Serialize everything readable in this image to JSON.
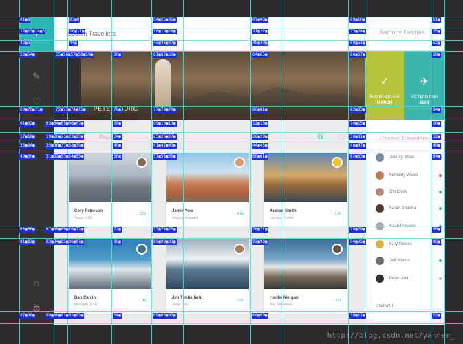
{
  "header": {
    "search_placeholder": "Search Travellers",
    "user_name": "Anthony Delmas"
  },
  "sidebar": {
    "logo_text": "T",
    "icons": [
      "compass-icon",
      "heart-icon",
      "inbox-icon",
      "settings-icon"
    ]
  },
  "hero": {
    "caption": "PETERSBURG",
    "best_time_label": "Best time to visit",
    "best_time_value": "MARCH",
    "flights_label": "20 flights from",
    "flights_value": "350 $",
    "colors": {
      "green_tile": "#b5c43a",
      "teal_tile": "#3bb5ad"
    }
  },
  "content": {
    "section_title": "Popular",
    "cards": [
      {
        "name": "Cory Peterson",
        "location": "Texas, USA",
        "likes": "255",
        "photo": "bridge-river-city"
      },
      {
        "name": "Jamie Yow",
        "location": "Sydney, Australia",
        "likes": "4.5k",
        "photo": "colorful-street"
      },
      {
        "name": "Keeran Smith",
        "location": "Istanbul, Turkey",
        "likes": "1.2k",
        "photo": "canal-sunset"
      },
      {
        "name": "Dan Calvin",
        "location": "Michigan, USA",
        "likes": "4k",
        "photo": "snowy-mountains"
      },
      {
        "name": "Jim Timberland",
        "location": "Sofia, Italy",
        "likes": "150",
        "photo": "ocean-waves"
      },
      {
        "name": "Hoolie Morgan",
        "location": "Bali, Indonesia",
        "likes": "22k",
        "photo": "mountain-lake"
      }
    ]
  },
  "travellers": {
    "title": "Recent Travellers",
    "list": [
      {
        "name": "Jeremy Shaw",
        "status_color": "#2bb7b3"
      },
      {
        "name": "Kimberly Wales",
        "status_color": "#e2574c"
      },
      {
        "name": "Chi Chow",
        "status_color": "#2bb7b3"
      },
      {
        "name": "Karan Sharma",
        "status_color": "#2bb7b3"
      },
      {
        "name": "Kaan Pervane",
        "status_color": "#2bb7b3"
      },
      {
        "name": "Katy Gomes",
        "status_color": "#e2574c"
      },
      {
        "name": "Jeff Walton",
        "status_color": "#2bb7b3"
      },
      {
        "name": "Peter John",
        "status_color": "#b0b0b0"
      }
    ],
    "chat_placeholder": "Chat with"
  },
  "watermark": "http://blog.csdn.net/yanner_",
  "accent_color": "#2bb7b3"
}
